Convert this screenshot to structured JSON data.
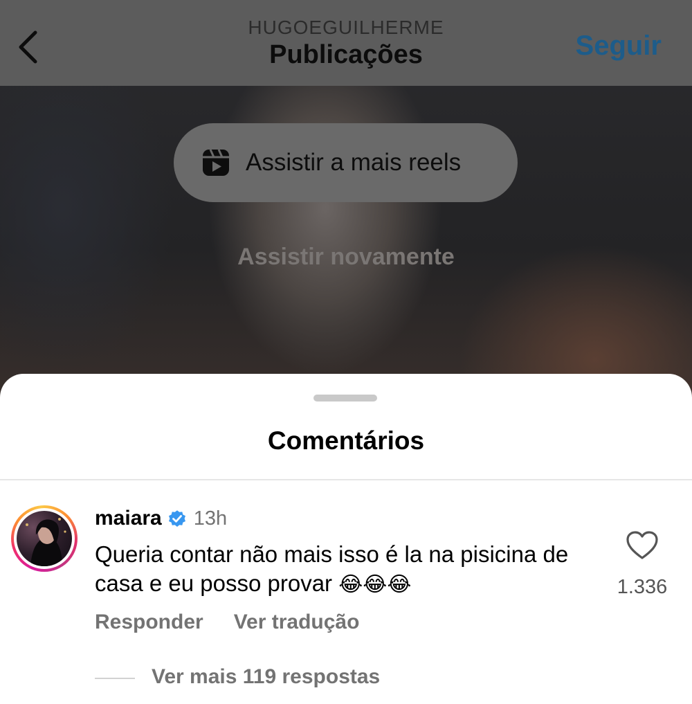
{
  "header": {
    "back_icon": "chevron-left-icon",
    "account": "HUGOEGUILHERME",
    "title": "Publicações",
    "follow_label": "Seguir"
  },
  "video": {
    "reels_icon": "reels-icon",
    "reels_label": "Assistir a mais reels",
    "replay_label": "Assistir novamente"
  },
  "comments": {
    "title": "Comentários",
    "items": [
      {
        "username": "maiara",
        "verified": true,
        "time": "13h",
        "text": "Queria contar não mais isso é la na pisicina de casa e eu posso provar",
        "emoji": "😂😂😂",
        "likes": "1.336",
        "reply_label": "Responder",
        "translate_label": "Ver tradução",
        "more_replies_label": "Ver mais 119 respostas"
      }
    ]
  },
  "colors": {
    "follow": "#1d5c8a",
    "verified": "#3897f0",
    "secondary_text": "#737373"
  }
}
